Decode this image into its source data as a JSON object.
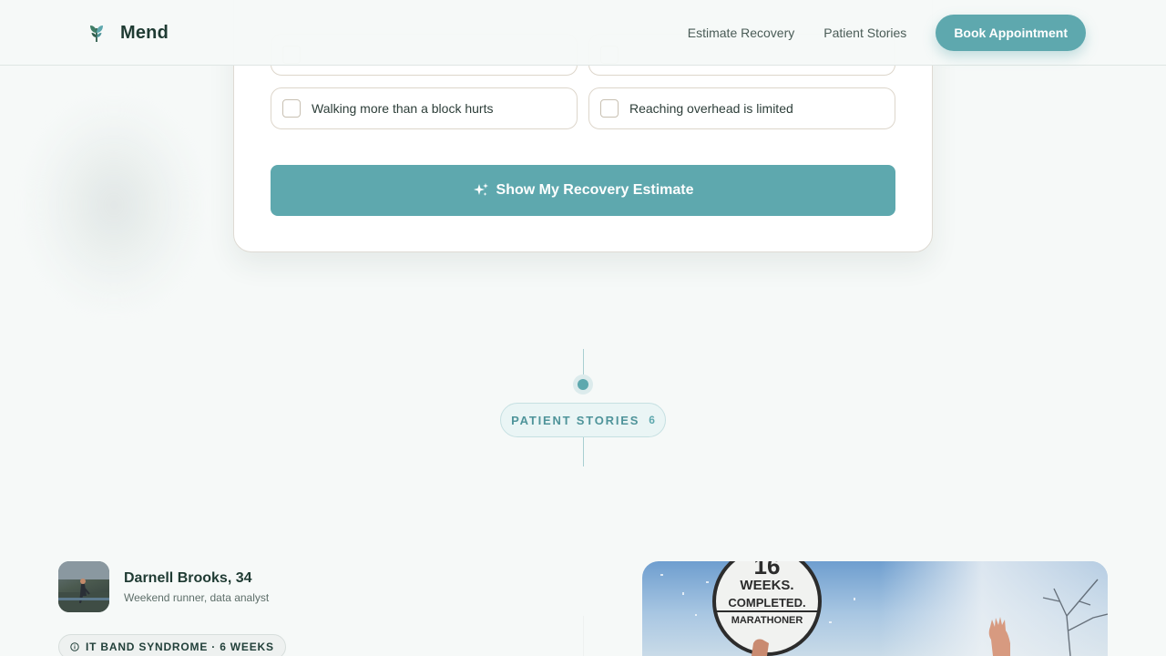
{
  "brand": {
    "name": "Mend",
    "logo_icon": "leaf-logo-icon"
  },
  "nav": {
    "links": [
      "Estimate Recovery",
      "Patient Stories"
    ],
    "cta_label": "Book Appointment"
  },
  "assessment": {
    "options": [
      {
        "label": ""
      },
      {
        "label": ""
      },
      {
        "label": "Walking more than a block hurts"
      },
      {
        "label": "Reaching overhead is limited"
      }
    ],
    "submit_label": "Show My Recovery Estimate",
    "submit_icon": "sparkle-icon"
  },
  "stories_section": {
    "label": "PATIENT STORIES",
    "count": "6"
  },
  "story": {
    "name": "Darnell Brooks, 34",
    "description": "Weekend runner, data analyst",
    "tag": "IT BAND SYNDROME · 6 WEEKS",
    "photo_sign": {
      "number": "16",
      "line1": "WEEKS.",
      "line2": "COMPLETED.",
      "line3": "MARATHONER"
    }
  },
  "colors": {
    "accent": "#5ea8ae",
    "text_dark": "#1f3b33",
    "background": "#f6f9f8"
  }
}
